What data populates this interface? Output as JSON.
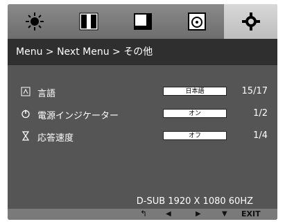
{
  "tabs": [
    {
      "icon": "brightness-icon"
    },
    {
      "icon": "color-bars-icon"
    },
    {
      "icon": "picture-size-icon"
    },
    {
      "icon": "disc-icon"
    },
    {
      "icon": "gear-icon",
      "active": true
    }
  ],
  "breadcrumb": "Menu > Next Menu > その他",
  "settings": [
    {
      "label": "言語",
      "value": "日本語",
      "count": "15/17",
      "icon": "language-icon"
    },
    {
      "label": "電源インジケーター",
      "value": "オン",
      "count": "1/2",
      "icon": "power-icon"
    },
    {
      "label": "応答速度",
      "value": "オフ",
      "count": "1/4",
      "icon": "hourglass-icon"
    }
  ],
  "status": {
    "signal": "D-SUB 1920 X 1080 60HZ"
  },
  "bottom_bar": {
    "keys": [
      {
        "icon": "return-icon",
        "glyph": "↰"
      },
      {
        "icon": "left-arrow-icon",
        "glyph": "◀"
      },
      {
        "icon": "right-arrow-icon",
        "glyph": "▶"
      },
      {
        "icon": "down-arrow-icon",
        "glyph": "▼"
      }
    ],
    "exit_label": "EXIT"
  }
}
